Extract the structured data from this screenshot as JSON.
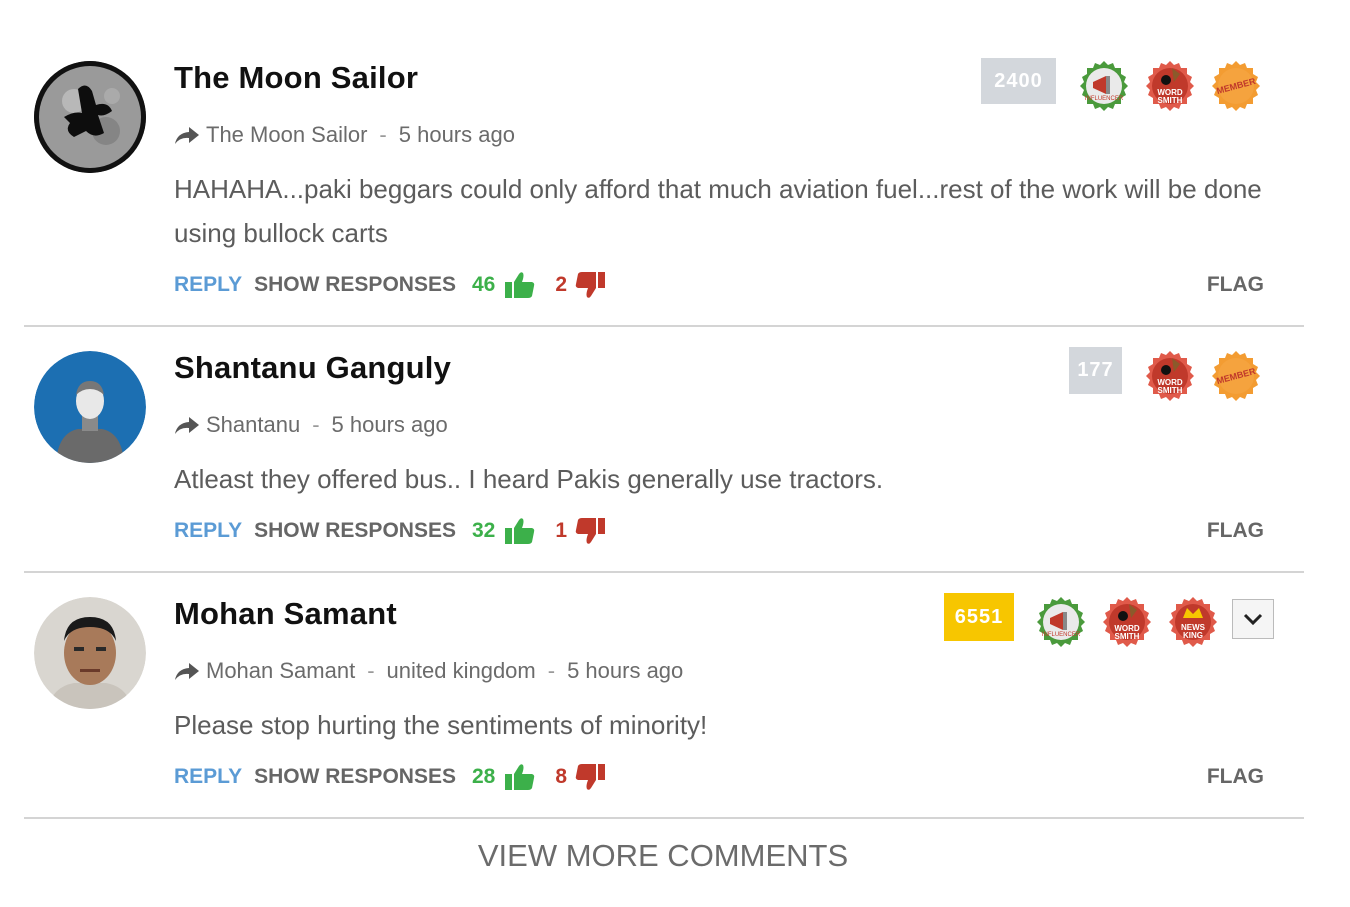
{
  "colors": {
    "upvote": "#3cb04a",
    "downvote": "#c0392b",
    "reply": "#5b9bd5",
    "score_gray": "#d3d7dc",
    "score_gold": "#f7c600"
  },
  "comments": [
    {
      "author": "The Moon Sailor",
      "handle": "The Moon Sailor",
      "time": "5 hours ago",
      "text": "HAHAHA...paki beggars could only afford that much aviation fuel...rest of the work will be done using bullock carts",
      "score": "2400",
      "badges": [
        "influencer-badge-icon",
        "word-smith-badge-icon",
        "member-badge-icon"
      ],
      "reply_label": "REPLY",
      "show_responses_label": "SHOW RESPONSES",
      "upvotes": "46",
      "downvotes": "2",
      "flag_label": "FLAG"
    },
    {
      "author": "Shantanu Ganguly",
      "handle": "Shantanu",
      "time": "5 hours ago",
      "text": "Atleast they offered bus.. I heard Pakis generally use tractors.",
      "score": "177",
      "badges": [
        "word-smith-badge-icon",
        "member-badge-icon"
      ],
      "reply_label": "REPLY",
      "show_responses_label": "SHOW RESPONSES",
      "upvotes": "32",
      "downvotes": "1",
      "flag_label": "FLAG"
    },
    {
      "author": "Mohan Samant",
      "handle": "Mohan Samant",
      "location": "united kingdom",
      "time": "5 hours ago",
      "text": "Please stop hurting the sentiments of minority!",
      "score": "6551",
      "badges": [
        "influencer-badge-icon",
        "word-smith-badge-icon",
        "news-king-badge-icon"
      ],
      "reply_label": "REPLY",
      "show_responses_label": "SHOW RESPONSES",
      "upvotes": "28",
      "downvotes": "8",
      "flag_label": "FLAG"
    }
  ],
  "badge_labels": {
    "influencer": "INFLUENCER",
    "word_smith_1": "WORD",
    "word_smith_2": "SMITH",
    "member": "MEMBER",
    "news_king_1": "NEWS",
    "news_king_2": "KING"
  },
  "view_more_label": "VIEW MORE COMMENTS"
}
